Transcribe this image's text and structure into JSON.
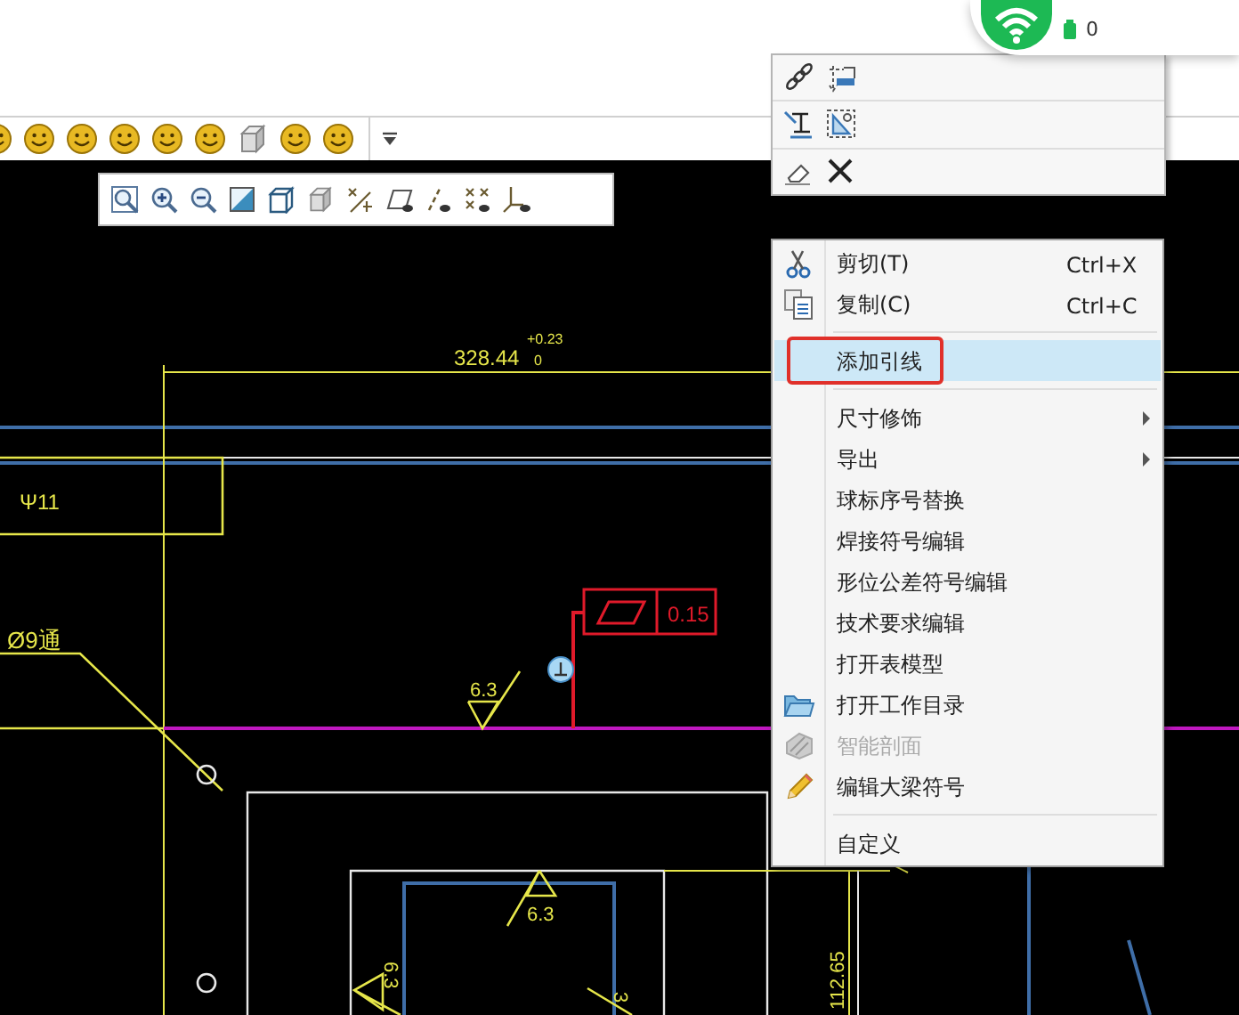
{
  "network_widget": {
    "reading": "0"
  },
  "context_menu": {
    "items": [
      {
        "kind": "item",
        "label": "剪切(T)",
        "shortcut": "Ctrl+X",
        "selected": false,
        "disabled": false,
        "submenu": false
      },
      {
        "kind": "item",
        "label": "复制(C)",
        "shortcut": "Ctrl+C",
        "selected": false,
        "disabled": false,
        "submenu": false
      },
      {
        "kind": "separator"
      },
      {
        "kind": "item",
        "label": "添加引线",
        "selected": true,
        "disabled": false,
        "submenu": false
      },
      {
        "kind": "separator"
      },
      {
        "kind": "item",
        "label": "尺寸修饰",
        "selected": false,
        "disabled": false,
        "submenu": true
      },
      {
        "kind": "item",
        "label": "导出",
        "selected": false,
        "disabled": false,
        "submenu": true
      },
      {
        "kind": "item",
        "label": "球标序号替换",
        "selected": false,
        "disabled": false,
        "submenu": false
      },
      {
        "kind": "item",
        "label": "焊接符号编辑",
        "selected": false,
        "disabled": false,
        "submenu": false
      },
      {
        "kind": "item",
        "label": "形位公差符号编辑",
        "selected": false,
        "disabled": false,
        "submenu": false
      },
      {
        "kind": "item",
        "label": "技术要求编辑",
        "selected": false,
        "disabled": false,
        "submenu": false
      },
      {
        "kind": "item",
        "label": "打开表模型",
        "selected": false,
        "disabled": false,
        "submenu": false
      },
      {
        "kind": "item",
        "label": "打开工作目录",
        "selected": false,
        "disabled": false,
        "submenu": false
      },
      {
        "kind": "item",
        "label": "智能剖面",
        "selected": false,
        "disabled": true,
        "submenu": false
      },
      {
        "kind": "item",
        "label": "编辑大梁符号",
        "selected": false,
        "disabled": false,
        "submenu": false
      },
      {
        "kind": "separator"
      },
      {
        "kind": "item",
        "label": "自定义",
        "selected": false,
        "disabled": false,
        "submenu": false
      }
    ]
  },
  "drawing": {
    "dimension": {
      "value": "328.44",
      "upper_tolerance": "+0.23",
      "lower_tolerance": "0"
    },
    "fit_label": "Ψ11",
    "hole_label": "Ø9通",
    "roughness_labels": [
      "6.3",
      "6.3",
      "6.3",
      "3"
    ],
    "tolerance_frame": {
      "value": "0.15"
    },
    "vertical_dimension": "112.65"
  }
}
